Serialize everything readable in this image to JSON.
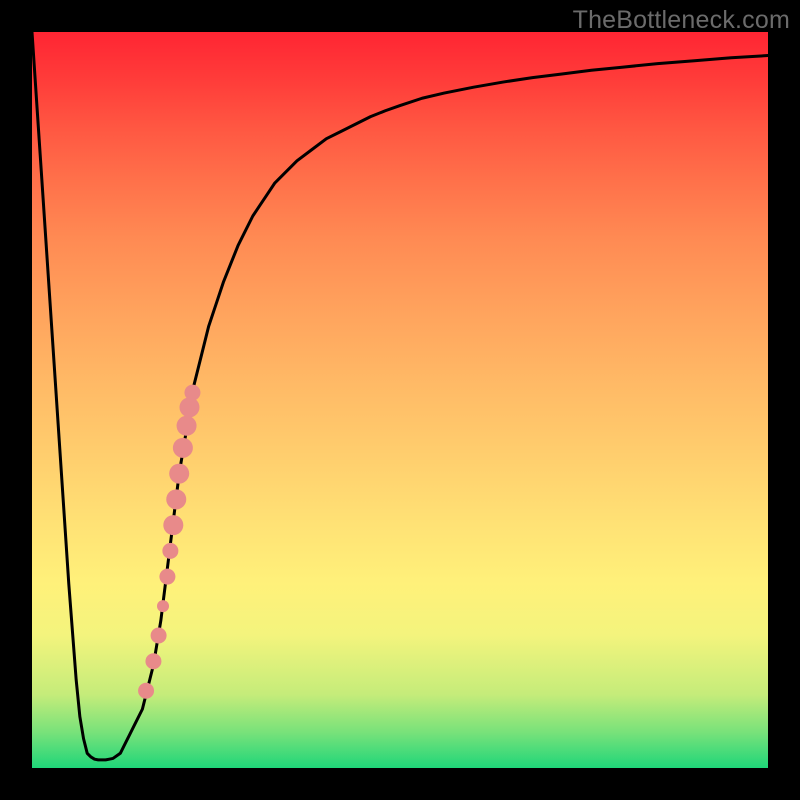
{
  "watermark": "TheBottleneck.com",
  "chart_data": {
    "type": "line",
    "title": "",
    "xlabel": "",
    "ylabel": "",
    "xlim": [
      0,
      1
    ],
    "ylim": [
      0,
      1
    ],
    "curve": {
      "name": "bottleneck-curve",
      "color": "#000000",
      "x": [
        0.0,
        0.03,
        0.05,
        0.06,
        0.065,
        0.07,
        0.075,
        0.08,
        0.085,
        0.09,
        0.095,
        0.1,
        0.105,
        0.11,
        0.12,
        0.13,
        0.14,
        0.15,
        0.155,
        0.16,
        0.165,
        0.17,
        0.175,
        0.18,
        0.185,
        0.19,
        0.195,
        0.2,
        0.21,
        0.22,
        0.23,
        0.24,
        0.25,
        0.26,
        0.27,
        0.28,
        0.29,
        0.3,
        0.31,
        0.32,
        0.33,
        0.34,
        0.35,
        0.36,
        0.38,
        0.4,
        0.42,
        0.44,
        0.46,
        0.48,
        0.5,
        0.53,
        0.56,
        0.6,
        0.64,
        0.68,
        0.72,
        0.76,
        0.8,
        0.85,
        0.9,
        0.95,
        1.0
      ],
      "y": [
        1.0,
        0.55,
        0.25,
        0.12,
        0.07,
        0.04,
        0.02,
        0.015,
        0.012,
        0.011,
        0.011,
        0.011,
        0.012,
        0.013,
        0.02,
        0.04,
        0.06,
        0.08,
        0.1,
        0.12,
        0.14,
        0.17,
        0.2,
        0.24,
        0.28,
        0.32,
        0.36,
        0.4,
        0.46,
        0.52,
        0.56,
        0.6,
        0.63,
        0.66,
        0.685,
        0.71,
        0.73,
        0.75,
        0.765,
        0.78,
        0.795,
        0.805,
        0.815,
        0.825,
        0.84,
        0.855,
        0.865,
        0.875,
        0.885,
        0.893,
        0.9,
        0.91,
        0.917,
        0.925,
        0.932,
        0.938,
        0.943,
        0.948,
        0.952,
        0.957,
        0.961,
        0.965,
        0.968
      ]
    },
    "markers": {
      "name": "highlighted-points",
      "color": "#e88a8a",
      "points": [
        {
          "x": 0.155,
          "y": 0.105,
          "r": 8
        },
        {
          "x": 0.165,
          "y": 0.145,
          "r": 8
        },
        {
          "x": 0.172,
          "y": 0.18,
          "r": 8
        },
        {
          "x": 0.178,
          "y": 0.22,
          "r": 6
        },
        {
          "x": 0.184,
          "y": 0.26,
          "r": 8
        },
        {
          "x": 0.188,
          "y": 0.295,
          "r": 8
        },
        {
          "x": 0.192,
          "y": 0.33,
          "r": 10
        },
        {
          "x": 0.196,
          "y": 0.365,
          "r": 10
        },
        {
          "x": 0.2,
          "y": 0.4,
          "r": 10
        },
        {
          "x": 0.205,
          "y": 0.435,
          "r": 10
        },
        {
          "x": 0.21,
          "y": 0.465,
          "r": 10
        },
        {
          "x": 0.214,
          "y": 0.49,
          "r": 10
        },
        {
          "x": 0.218,
          "y": 0.51,
          "r": 8
        }
      ]
    }
  }
}
